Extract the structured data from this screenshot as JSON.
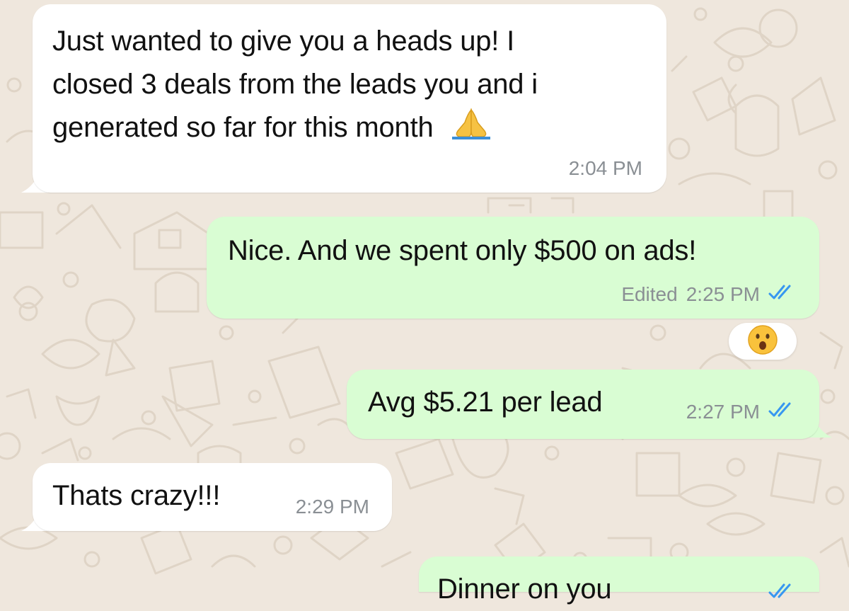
{
  "colors": {
    "incoming_bubble": "#ffffff",
    "outgoing_bubble": "#d9fdd3",
    "wallpaper": "#efe7dd",
    "meta_text": "#8a8f94",
    "read_ticks": "#3797f0"
  },
  "messages": [
    {
      "direction": "incoming",
      "lines": [
        "Just wanted to give you a heads up! I",
        "closed 3 deals from the leads you and i",
        "generated so far for this month"
      ],
      "emoji": "🙏",
      "emoji_name": "folded-hands",
      "time": "2:04 PM"
    },
    {
      "direction": "outgoing",
      "text": "Nice. And we spent only $500 on ads!",
      "edited_label": "Edited",
      "time": "2:25 PM",
      "status_icon": "double-check-read-icon",
      "reaction": "😮",
      "reaction_name": "face-with-open-mouth"
    },
    {
      "direction": "outgoing",
      "text": "Avg $5.21 per lead",
      "time": "2:27 PM",
      "status_icon": "double-check-read-icon"
    },
    {
      "direction": "incoming",
      "text": "Thats crazy!!!",
      "time": "2:29 PM"
    },
    {
      "direction": "outgoing",
      "text": "Dinner on you",
      "status_icon": "double-check-read-icon"
    }
  ]
}
